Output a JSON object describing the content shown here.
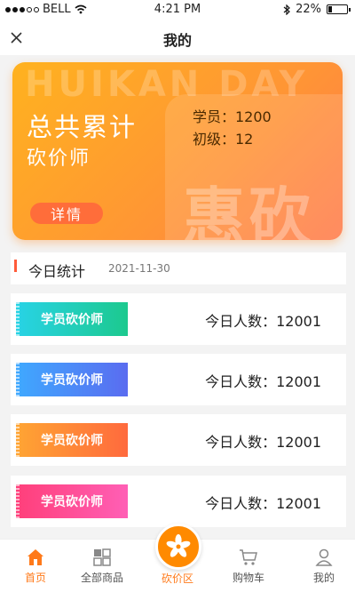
{
  "status_bar": {
    "carrier": "BELL",
    "time": "4:21 PM",
    "battery": "22%",
    "battery_level": 0.22
  },
  "nav": {
    "title": "我的"
  },
  "banner": {
    "bg_text": "HUIKAN DAY",
    "big_char": "惠砍",
    "headline": "总共累计",
    "subline": "砍价师",
    "stat_students": "学员：1200",
    "stat_level": "初级：12",
    "detail_label": "详情"
  },
  "today": {
    "label": "今日统计",
    "date": "2021-11-30"
  },
  "cards": [
    {
      "tag": "学员砍价师",
      "count": "今日人数：12001",
      "color_from": "#28d3e6",
      "color_to": "#1cc98e"
    },
    {
      "tag": "学员砍价师",
      "count": "今日人数：12001",
      "color_from": "#3fa9ff",
      "color_to": "#5a6cf0"
    },
    {
      "tag": "学员砍价师",
      "count": "今日人数：12001",
      "color_from": "#ffa533",
      "color_to": "#ff6a3d"
    },
    {
      "tag": "学员砍价师",
      "count": "今日人数：12001",
      "color_from": "#ff3f7a",
      "color_to": "#ff5fb5"
    }
  ],
  "tabs": [
    {
      "label": "首页",
      "icon": "home-icon"
    },
    {
      "label": "全部商品",
      "icon": "grid-icon"
    },
    {
      "label": "砍价区",
      "icon": "flower-icon"
    },
    {
      "label": "购物车",
      "icon": "cart-icon"
    },
    {
      "label": "我的",
      "icon": "user-icon"
    }
  ],
  "colors": {
    "accent": "#ff7a1a",
    "banner_start": "#ffb21f",
    "banner_end": "#ff7a4a"
  }
}
